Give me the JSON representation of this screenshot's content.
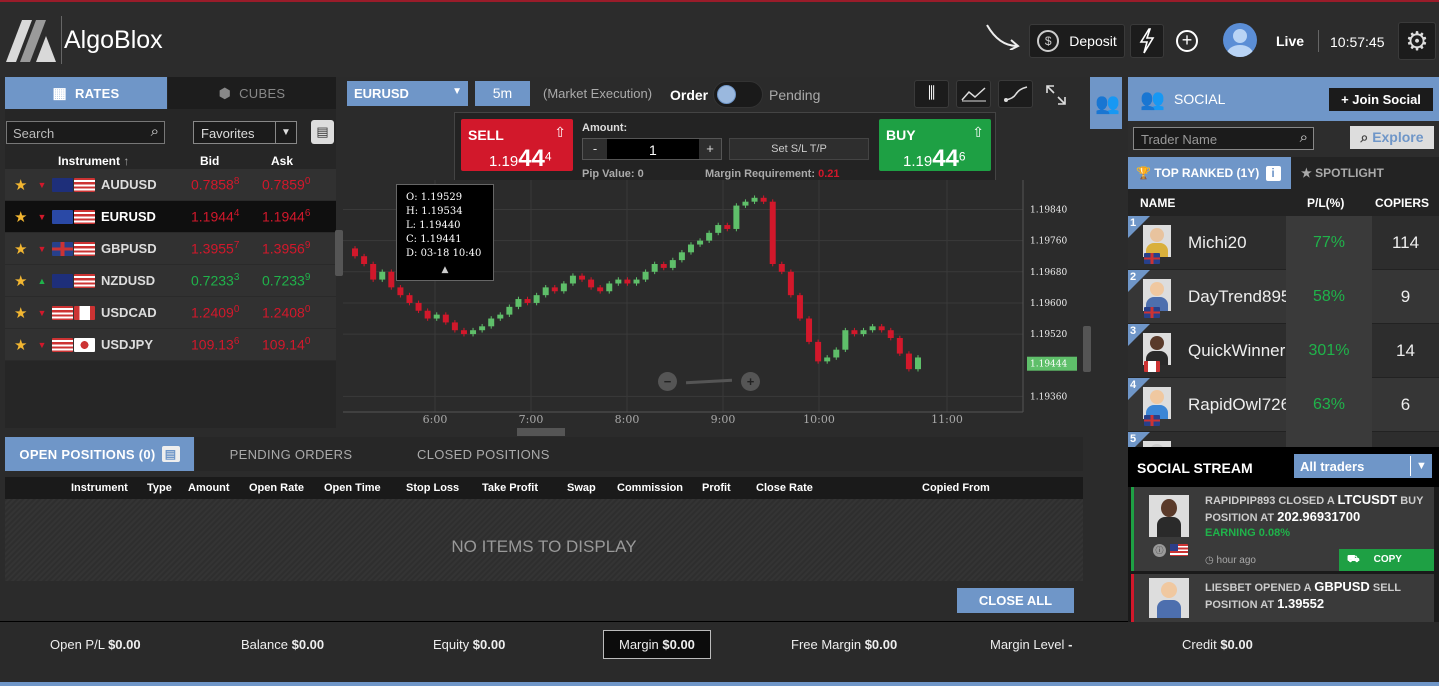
{
  "app": {
    "name": "AlgoBlox"
  },
  "topbar": {
    "deposit_label": "Deposit",
    "mode": "Live",
    "time": "10:57:45"
  },
  "left": {
    "tabs": [
      {
        "label": "RATES"
      },
      {
        "label": "CUBES"
      }
    ],
    "search_placeholder": "Search",
    "filter_value": "Favorites",
    "columns": {
      "instrument": "Instrument",
      "bid": "Bid",
      "ask": "Ask"
    },
    "rates": [
      {
        "symbol": "AUDUSD",
        "bid_main": "0.7858",
        "bid_sup": "8",
        "ask_main": "0.7859",
        "ask_sup": "0",
        "dir": "down"
      },
      {
        "symbol": "EURUSD",
        "bid_main": "1.1944",
        "bid_sup": "4",
        "ask_main": "1.1944",
        "ask_sup": "6",
        "dir": "down"
      },
      {
        "symbol": "GBPUSD",
        "bid_main": "1.3955",
        "bid_sup": "7",
        "ask_main": "1.3956",
        "ask_sup": "9",
        "dir": "down"
      },
      {
        "symbol": "NZDUSD",
        "bid_main": "0.7233",
        "bid_sup": "3",
        "ask_main": "0.7233",
        "ask_sup": "9",
        "dir": "up"
      },
      {
        "symbol": "USDCAD",
        "bid_main": "1.2409",
        "bid_sup": "0",
        "ask_main": "1.2408",
        "ask_sup": "0",
        "dir": "down"
      },
      {
        "symbol": "USDJPY",
        "bid_main": "109.13",
        "bid_sup": "6",
        "ask_main": "109.14",
        "ask_sup": "0",
        "dir": "down"
      }
    ]
  },
  "chart": {
    "symbol": "EURUSD",
    "timeframe": "5m",
    "execution": "(Market Execution)",
    "order_label": "Order",
    "pending_label": "Pending",
    "sell_label": "SELL",
    "sell_main": "1.19",
    "sell_big": "44",
    "sell_sup": "4",
    "buy_label": "BUY",
    "buy_main": "1.19",
    "buy_big": "44",
    "buy_sup": "6",
    "amount_label": "Amount:",
    "amount_value": "1",
    "sltp_label": "Set S/L T/P",
    "pip_value": "Pip Value: 0",
    "margin_req_label": "Margin Requirement:",
    "margin_req_value": "0.21",
    "tooltip": {
      "o": "O: 1.19529",
      "h": "H: 1.19534",
      "l": "L: 1.19440",
      "c": "C: 1.19441",
      "d": "D: 03-18 10:40"
    },
    "y_ticks": [
      "1.19840",
      "1.19760",
      "1.19680",
      "1.19600",
      "1.19520",
      "1.19444",
      "1.19360"
    ],
    "x_ticks": [
      "6:00",
      "7:00",
      "8:00",
      "9:00",
      "10:00",
      "11:00"
    ]
  },
  "chart_data": {
    "type": "candlestick",
    "ylim": [
      1.1932,
      1.1989
    ],
    "last_price": 1.19444,
    "x_ticks": [
      "6:00",
      "7:00",
      "8:00",
      "9:00",
      "10:00",
      "11:00"
    ],
    "closes": [
      1.1972,
      1.197,
      1.1966,
      1.1968,
      1.1964,
      1.1962,
      1.196,
      1.1958,
      1.1956,
      1.1957,
      1.1955,
      1.1953,
      1.1952,
      1.1953,
      1.1954,
      1.1956,
      1.1957,
      1.1959,
      1.1961,
      1.196,
      1.1962,
      1.1964,
      1.1963,
      1.1965,
      1.1967,
      1.1966,
      1.1964,
      1.1963,
      1.1965,
      1.1966,
      1.1965,
      1.1966,
      1.1968,
      1.197,
      1.1969,
      1.1971,
      1.1973,
      1.1975,
      1.1976,
      1.1978,
      1.198,
      1.1979,
      1.1985,
      1.1986,
      1.1987,
      1.1986,
      1.197,
      1.1968,
      1.1962,
      1.1956,
      1.195,
      1.1945,
      1.1946,
      1.1948,
      1.1953,
      1.1952,
      1.1953,
      1.1954,
      1.1953,
      1.1951,
      1.1947,
      1.1943,
      1.1946
    ]
  },
  "positions": {
    "tabs": [
      {
        "label": "OPEN POSITIONS (0)"
      },
      {
        "label": "PENDING ORDERS"
      },
      {
        "label": "CLOSED POSITIONS"
      }
    ],
    "columns": [
      "Instrument",
      "Type",
      "Amount",
      "Open Rate",
      "Open Time",
      "Stop Loss",
      "Take Profit",
      "Swap",
      "Commission",
      "Profit",
      "Close Rate",
      "Copied From"
    ],
    "empty_text": "NO ITEMS TO DISPLAY",
    "close_all": "CLOSE ALL"
  },
  "summary": [
    {
      "label": "Open P/L",
      "value": "$0.00"
    },
    {
      "label": "Balance",
      "value": "$0.00"
    },
    {
      "label": "Equity",
      "value": "$0.00"
    },
    {
      "label": "Margin",
      "value": "$0.00"
    },
    {
      "label": "Free Margin",
      "value": "$0.00"
    },
    {
      "label": "Margin Level",
      "value": "-"
    },
    {
      "label": "Credit",
      "value": "$0.00"
    }
  ],
  "social": {
    "title": "SOCIAL",
    "join_label": "Join Social",
    "search_placeholder": "Trader Name",
    "explore_label": "Explore",
    "tabs": [
      {
        "label": "TOP RANKED (1Y)"
      },
      {
        "label": "SPOTLIGHT"
      }
    ],
    "columns": {
      "name": "NAME",
      "pl": "P/L(%)",
      "copiers": "COPIERS"
    },
    "traders": [
      {
        "rank": "1",
        "name": "Michi20",
        "pl": "77%",
        "copiers": "114"
      },
      {
        "rank": "2",
        "name": "DayTrend895",
        "pl": "58%",
        "copiers": "9"
      },
      {
        "rank": "3",
        "name": "QuickWinner",
        "pl": "301%",
        "copiers": "14"
      },
      {
        "rank": "4",
        "name": "RapidOwl726",
        "pl": "63%",
        "copiers": "6"
      },
      {
        "rank": "5",
        "name": "",
        "pl": "",
        "copiers": ""
      }
    ],
    "stream_title": "SOCIAL STREAM",
    "stream_filter": "All traders",
    "stream": [
      {
        "prefix": "RAPIDPIP893 CLOSED A ",
        "sym": "LTCUSDT",
        "mid": " BUY POSITION AT ",
        "price": "202.96931700",
        "earning": "EARNING 0.08%",
        "time": "hour ago",
        "copy": "COPY"
      },
      {
        "prefix": "LIESBET OPENED A ",
        "sym": "GBPUSD",
        "mid": " SELL POSITION AT ",
        "price": "1.39552",
        "earning": "",
        "time": "",
        "copy": ""
      }
    ]
  },
  "colors": {
    "accent": "#6f96c8",
    "sell": "#d2182b",
    "buy": "#1ea044",
    "up": "#1fb34a",
    "down": "#d2182b"
  }
}
